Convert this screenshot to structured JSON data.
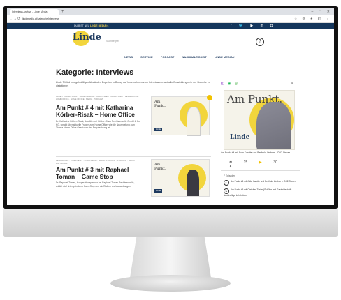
{
  "browser": {
    "tab_title": "Interviews Archive - Linde Media",
    "new_tab": "+",
    "window_controls": "– ▢ ✕",
    "nav": {
      "back": "←",
      "forward": "→",
      "reload": "⟳"
    },
    "url": "lindemedia.at/kategorie/interviews",
    "ext_icons": "☆ ⚙ ★ ◧ ⋮"
  },
  "topbar": {
    "text": "DU BIST NEU",
    "link": "LINDE MEDIA ▷",
    "social": [
      "f",
      "🐦",
      "▶",
      "in",
      "◘"
    ]
  },
  "header": {
    "logo": "Linde",
    "search_placeholder": "Suchbegriff",
    "help_icon": "?",
    "nav": [
      "NEWS",
      "SERVICE",
      "PODCAST",
      "NACHHALTIGKEIT",
      "LINDE MEDIA ▾"
    ]
  },
  "main": {
    "category_title": "Kategorie: Interviews",
    "intro": "Linde TV läd in regelmäßigen Abständen Experten in Bezug auf Unternehmen zum Interview ein: aktuelle Entwicklungen in der Branche zu diskutieren.",
    "articles": [
      {
        "meta": "ARBEIT · ARBEITSWELT · ARBEITSRECHT · ARBEITSZEIT · ARBEITSZEIT · BEWERBUNG · HOMEOFFICE · HOME OFFICE · MEDIA · PODCAST",
        "title": "Am Punkt # 4 mit Katharina Körber-Risak – Home Office",
        "excerpt": "Dr. Katharina Körber-Risak, Anwältin bei Körber-Risak Rechtsanwalts GmbH & Co KG, spricht über aktuelle Fragen zum Home Office, wie die Neuregelung zum Thema Home Office Gesetz vor der Begutachtung ist.",
        "thumb_title": "Am Punkt.",
        "thumb_badge": "Linde"
      },
      {
        "meta": "BEWERBUNG · INTERVIEWS · LINDE MEDIA · MEDIA · PODCAST · PODCAST · SPORT · WIRTSCHAFT",
        "title": "Am Punkt # 3 mit Raphael Toman – Game Stop",
        "excerpt": "Dr. Raphael Toman, Kooperationspartner bei Raphael Toman Rechtsanwalts, erklärt die Hintergründe zu GameStop und die Risiken und Auswirkungen.",
        "thumb_title": "Am Punkt.",
        "thumb_badge": "Linde"
      }
    ]
  },
  "sidebar": {
    "platforms": [
      "◧",
      "◉",
      "◎",
      "✉"
    ],
    "cover_title": "Am Punkt.",
    "cover_logo": "Linde",
    "episode_title": "Am Punkt #4 mit Aura Karotte und Berthold Lindner – CO2-Steuer",
    "controls": [
      "⟲",
      "15",
      "▶",
      "30",
      "⬇"
    ],
    "episode_count": "7 Episoden",
    "episodes": [
      "Am Punkt #6 mit Julia Karotte und Berthold Lindner – CO2-Steuer",
      "Am Punkt #5 mit Christian Tasler (Schüler und Gastwirtschaft) – Nachhaltige Lehrbrüder"
    ]
  }
}
